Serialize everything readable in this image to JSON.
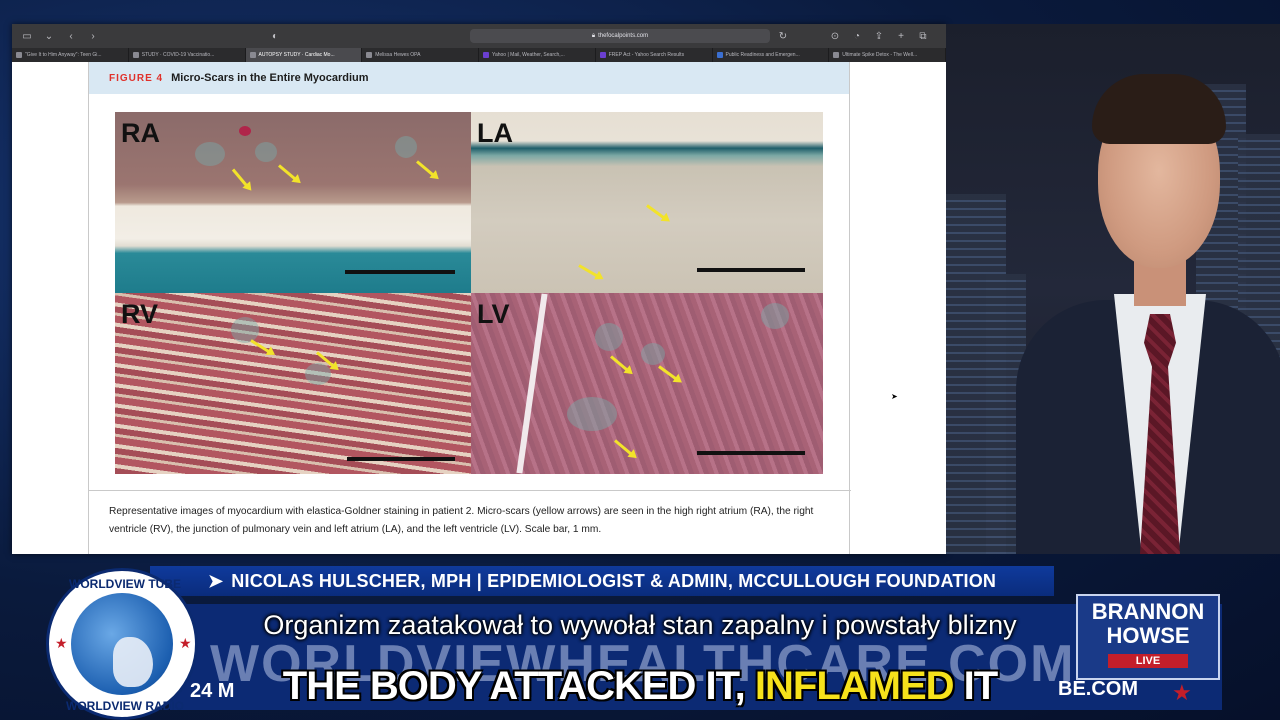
{
  "browser": {
    "url": "thefocalpoints.com",
    "tabs": [
      "\"Give It to Him Anyway\": Teen Gi...",
      "STUDY · COVID-19 Vaccinatio...",
      "AUTOPSY STUDY · Cardiac Mo...",
      "Melissa Hewes OPA",
      "Yahoo | Mail, Weather, Search,...",
      "FREP Act - Yahoo Search Results",
      "Public Readiness and Emergen...",
      "Ultimate Spike Detox - The Well..."
    ],
    "active_tab": 2
  },
  "figure": {
    "label": "FIGURE 4",
    "title": "Micro-Scars in the Entire Myocardium",
    "panels": [
      "RA",
      "LA",
      "RV",
      "LV"
    ],
    "caption": "Representative images of myocardium with elastica-Goldner staining in patient 2. Micro-scars (yellow arrows) are seen in the high right atrium (RA), the right ventricle (RV), the junction of pulmonary vein and left atrium (LA), and the left ventricle (LV). Scale bar, 1 mm."
  },
  "broadcast": {
    "banner": "NICOLAS HULSCHER, MPH | EPIDEMIOLOGIST & ADMIN, MCCULLOUGH FOUNDATION",
    "background_text": "WORLDVIEWHEALTHCARE.COM",
    "ticker_left": "24 M",
    "ticker_right": "BE.COM",
    "logo_top": "WORLDVIEW TUBE",
    "logo_bottom": "WORLDVIEW RADIO",
    "show_name": "BRANNON HOWSE",
    "live": "LIVE",
    "subtitle_pl": "Organizm zaatakował to  wywołał stan zapalny i powstały blizny",
    "caption_main": "THE BODY ATTACKED IT,",
    "caption_highlight": "INFLAMED",
    "caption_end": "IT"
  },
  "colors": {
    "figure_label": "#e0312b",
    "banner": "#0f3a9c",
    "highlight": "#f6e21b",
    "live_red": "#c41e2a"
  }
}
